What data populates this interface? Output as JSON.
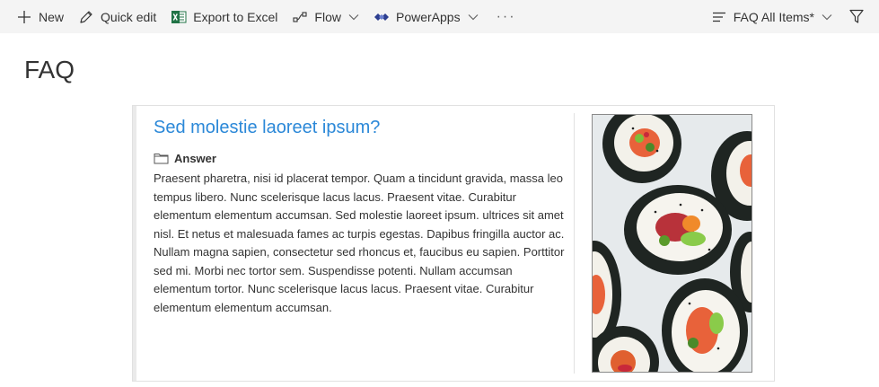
{
  "toolbar": {
    "new_label": "New",
    "quick_edit_label": "Quick edit",
    "export_label": "Export to Excel",
    "flow_label": "Flow",
    "powerapps_label": "PowerApps",
    "more_label": "···",
    "view_label": "FAQ All Items*"
  },
  "page": {
    "title": "FAQ"
  },
  "faq": {
    "question": "Sed molestie laoreet ipsum?",
    "answer_heading": "Answer",
    "answer_text": "Praesent pharetra, nisi id placerat tempor. Quam a tincidunt gravida, massa leo tempus libero. Nunc scelerisque lacus lacus. Praesent vitae. Curabitur elementum elementum accumsan. Sed molestie laoreet ipsum. ultrices sit amet nisl. Et netus et malesuada fames ac turpis egestas. Dapibus fringilla auctor ac. Nullam magna sapien, consectetur sed rhoncus et, faucibus eu sapien. Porttitor sed mi. Morbi nec tortor sem. Suspendisse potenti. Nullam accumsan elementum tortor. Nunc scelerisque lacus lacus. Praesent vitae. Curabitur elementum elementum accumsan."
  },
  "colors": {
    "accent_blue": "#2b88d8",
    "excel_green": "#217346",
    "powerapps_blue": "#2c3e8f"
  }
}
